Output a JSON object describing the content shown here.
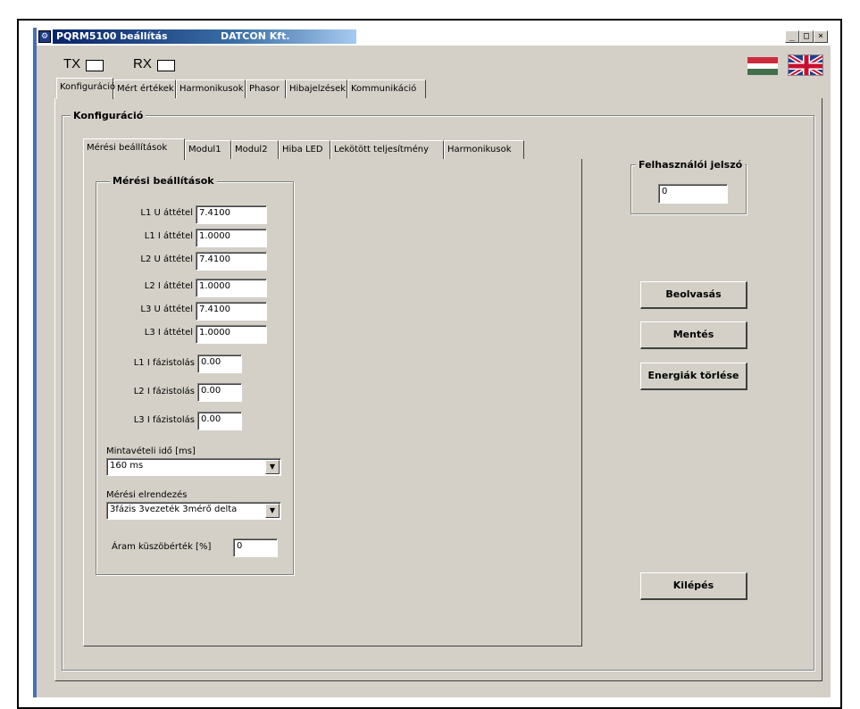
{
  "titlebar": {
    "app_title": "PQRM5100 beállítás",
    "company": "DATCON Kft.",
    "minimize_glyph": "_",
    "maximize_glyph": "□",
    "close_glyph": "×"
  },
  "indicators": {
    "tx_label": "TX",
    "rx_label": "RX"
  },
  "language": {
    "flag_hu_colors": [
      "#cd2a3e",
      "#ffffff",
      "#436f4d"
    ],
    "flag_uk_icon": "uk-flag-icon",
    "flag_hu_icon": "hu-flag-icon"
  },
  "main_tabs": [
    {
      "label": "Konfiguráció"
    },
    {
      "label": "Mért értékek"
    },
    {
      "label": "Harmonikusok"
    },
    {
      "label": "Phasor"
    },
    {
      "label": "Hibajelzések"
    },
    {
      "label": "Kommunikáció"
    }
  ],
  "config_group_label": "Konfiguráció",
  "sub_tabs": [
    {
      "label": "Mérési beállítások"
    },
    {
      "label": "Modul1"
    },
    {
      "label": "Modul2"
    },
    {
      "label": "Hiba LED"
    },
    {
      "label": "Lekötött teljesítmény"
    },
    {
      "label": "Harmonikusok"
    }
  ],
  "measurement": {
    "group_label": "Mérési beállítások",
    "fields": [
      {
        "label": "L1 U áttétel",
        "value": "7.4100"
      },
      {
        "label": "L1 I áttétel",
        "value": "1.0000"
      },
      {
        "label": "L2 U áttétel",
        "value": "7.4100"
      },
      {
        "label": "L2 I áttétel",
        "value": "1.0000"
      },
      {
        "label": "L3 U áttétel",
        "value": "7.4100"
      },
      {
        "label": "L3 I áttétel",
        "value": "1.0000"
      }
    ],
    "phase_fields": [
      {
        "label": "L1 I fázistolás",
        "value": "0.00"
      },
      {
        "label": "L2 I fázistolás",
        "value": "0.00"
      },
      {
        "label": "L3 I fázistolás",
        "value": "0.00"
      }
    ],
    "sampling_label": "Mintavételi idő [ms]",
    "sampling_value": "160 ms",
    "arrangement_label": "Mérési elrendezés",
    "arrangement_value": "3fázis 3vezeték 3mérő delta",
    "threshold_label": "Áram küszöbérték [%]",
    "threshold_value": "0"
  },
  "password": {
    "group_label": "Felhasználói jelszó",
    "value": "0"
  },
  "buttons": {
    "read": "Beolvasás",
    "save": "Mentés",
    "clear_energy": "Energiák törlése",
    "exit": "Kilépés"
  }
}
